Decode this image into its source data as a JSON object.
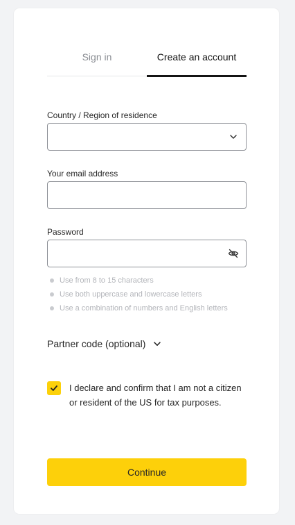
{
  "tabs": {
    "signin": "Sign in",
    "create": "Create an account"
  },
  "country": {
    "label": "Country / Region of residence",
    "value": "",
    "icon": "chevron-down-icon"
  },
  "email": {
    "label": "Your email address",
    "value": ""
  },
  "password": {
    "label": "Password",
    "value": "",
    "icon": "eye-off-icon",
    "rules": [
      "Use from 8 to 15 characters",
      "Use both uppercase and lowercase letters",
      "Use a combination of numbers and English letters"
    ]
  },
  "partner": {
    "label": "Partner code (optional)",
    "icon": "chevron-down-icon"
  },
  "declaration": {
    "checked": true,
    "text": "I declare and confirm that I am not a citizen or resident of the US for tax purposes."
  },
  "submit": {
    "label": "Continue"
  },
  "colors": {
    "accent": "#fdd00a",
    "background": "#f2f3f5",
    "card": "#ffffff"
  }
}
